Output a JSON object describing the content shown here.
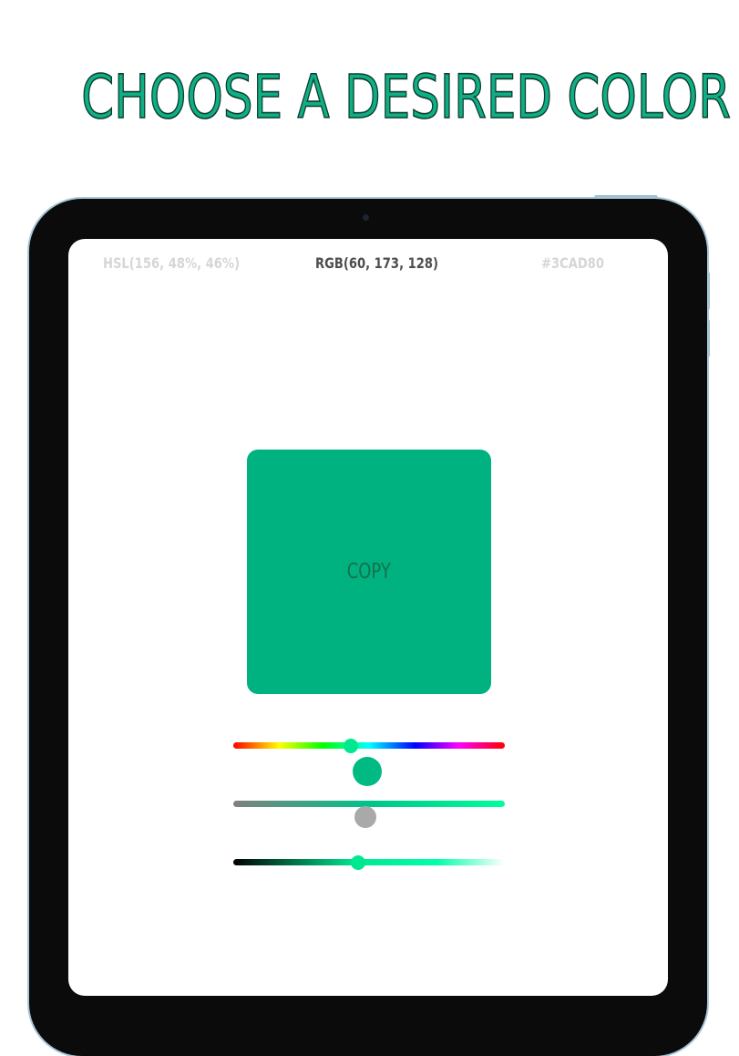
{
  "headline": "CHOOSE A DESIRED COLOR",
  "formats": {
    "hsl": "HSL(156, 48%, 46%)",
    "rgb": "RGB(60, 173, 128)",
    "hex": "#3CAD80",
    "active": "rgb"
  },
  "swatch": {
    "color": "#00B27F",
    "copy_label": "COPY"
  },
  "sliders": {
    "hue": {
      "value": 156,
      "max": 360,
      "thumb_color": "#00E88F"
    },
    "saturation": {
      "value": 48,
      "max": 100,
      "thumb_color": "#00BA84",
      "indicator_color": "#A9A9A9"
    },
    "lightness": {
      "value": 46,
      "max": 100,
      "thumb_color": "#00E88F"
    }
  },
  "colors": {
    "accent": "#0FAE84",
    "device_frame": "#0B0B0B",
    "device_edge": "#A9C6D6"
  }
}
